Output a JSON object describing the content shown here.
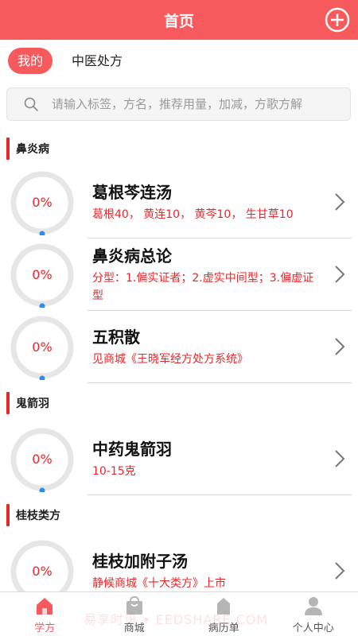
{
  "header": {
    "title": "首页",
    "add_icon": "plus-circle-icon"
  },
  "tabs": [
    {
      "label": "我的",
      "active": true
    },
    {
      "label": "中医处方",
      "active": false
    }
  ],
  "search": {
    "placeholder": "请输入标签，方名，推荐用量，加减，方歌方解",
    "icon": "search-icon"
  },
  "sections": [
    {
      "title": "鼻炎病",
      "items": [
        {
          "progress": "0%",
          "title": "葛根芩连汤",
          "subtitle": "葛根40， 黄连10， 黄芩10， 生甘草10"
        },
        {
          "progress": "0%",
          "title": "鼻炎病总论",
          "subtitle": "分型：1.偏实证者；2.虚实中间型；3.偏虚证型"
        },
        {
          "progress": "0%",
          "title": "五积散",
          "subtitle": "见商城《王晓军经方处方系统》"
        }
      ]
    },
    {
      "title": "鬼箭羽",
      "items": [
        {
          "progress": "0%",
          "title": "中药鬼箭羽",
          "subtitle": "10-15克"
        }
      ]
    },
    {
      "title": "桂枝类方",
      "items": [
        {
          "progress": "0%",
          "title": "桂枝加附子汤",
          "subtitle": "静候商城《十大类方》上市"
        }
      ]
    }
  ],
  "bottom_nav": [
    {
      "label": "学方",
      "icon": "home-icon",
      "active": true
    },
    {
      "label": "商城",
      "icon": "shop-bag-icon",
      "active": false
    },
    {
      "label": "病历单",
      "icon": "record-icon",
      "active": false
    },
    {
      "label": "个人中心",
      "icon": "user-icon",
      "active": false
    }
  ],
  "watermark": "易享时讯 • EEDSHARE.COM",
  "colors": {
    "accent": "#f65a5c",
    "text_red": "#e8272b",
    "ring_gray": "#e6e6e6",
    "ring_dot": "#2e8cf0"
  }
}
